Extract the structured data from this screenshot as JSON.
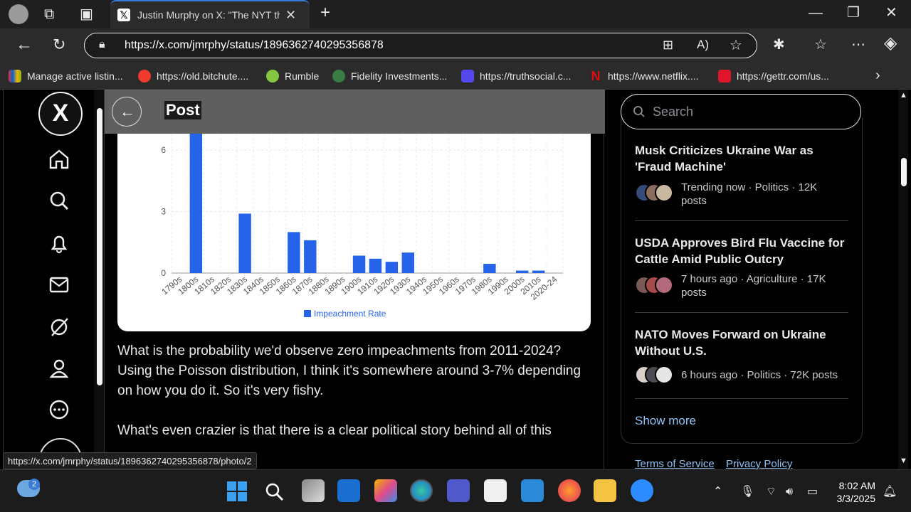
{
  "browser": {
    "tab_title": "Justin Murphy on X: \"The NYT thi",
    "url": "https://x.com/jmrphy/status/1896362740295356878",
    "status_url": "https://x.com/jmrphy/status/1896362740295356878/photo/2",
    "bookmarks": [
      {
        "label": "Manage active listin...",
        "color": "#e53238"
      },
      {
        "label": "https://old.bitchute....",
        "color": "#ef3a2d"
      },
      {
        "label": "Rumble",
        "color": "#85c742"
      },
      {
        "label": "Fidelity Investments...",
        "color": "#3a7d44"
      },
      {
        "label": "https://truthsocial.c...",
        "color": "#5448ee"
      },
      {
        "label": "https://www.netflix....",
        "color": "#e50914"
      },
      {
        "label": "https://gettr.com/us...",
        "color": "#e0152b"
      }
    ]
  },
  "post": {
    "header_title": "Post",
    "paragraph1": "What is the probability we'd observe zero impeachments from 2011-2024? Using the Poisson distribution, I think it's somewhere around 3-7% depending on how you do it. So it's very fishy.",
    "paragraph2": "What's even crazier is that there is a clear political story behind all of this"
  },
  "chart_data": {
    "type": "bar",
    "categories": [
      "1790s",
      "1800s",
      "1810s",
      "1820s",
      "1830s",
      "1840s",
      "1850s",
      "1860s",
      "1870s",
      "1880s",
      "1890s",
      "1900s",
      "1910s",
      "1920s",
      "1930s",
      "1940s",
      "1950s",
      "1960s",
      "1970s",
      "1980s",
      "1990s",
      "2000s",
      "2010s",
      "2020-24"
    ],
    "series": [
      {
        "name": "Impeachment Rate",
        "color": "#2563eb",
        "values": [
          0,
          6.8,
          0,
          0,
          2.9,
          0,
          0,
          2.0,
          1.6,
          0,
          0,
          0.85,
          0.7,
          0.55,
          1.0,
          0,
          0,
          0,
          0,
          0.45,
          0,
          0.12,
          0.12,
          0
        ]
      }
    ],
    "yticks": [
      0,
      3,
      6
    ],
    "ylim": [
      0,
      6.8
    ],
    "legend": "bottom",
    "grid": true
  },
  "sidebar": {
    "search_placeholder": "Search",
    "trends": [
      {
        "title": "Musk Criticizes Ukraine War as 'Fraud Machine'",
        "meta": "Trending now · Politics · 12K posts"
      },
      {
        "title": "USDA Approves Bird Flu Vaccine for Cattle Amid Public Outcry",
        "meta": "7 hours ago · Agriculture · 17K posts"
      },
      {
        "title": "NATO Moves Forward on Ukraine Without U.S.",
        "meta": "6 hours ago · Politics · 72K posts"
      }
    ],
    "show_more": "Show more",
    "footer": {
      "terms": "Terms of Service",
      "privacy": "Privacy Policy"
    }
  },
  "taskbar": {
    "weather_badge": "2",
    "time": "8:02 AM",
    "date": "3/3/2025"
  }
}
